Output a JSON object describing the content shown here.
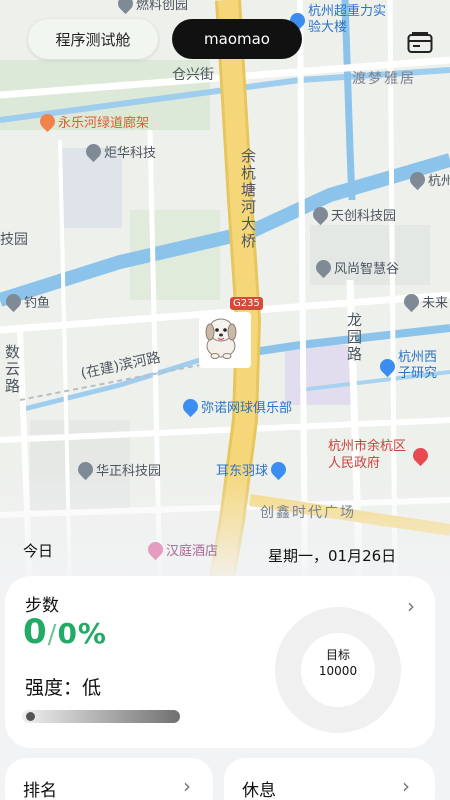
{
  "header": {
    "app_button": "程序测试舱",
    "user_button": "maomao",
    "wallet_icon": "wallet-icon"
  },
  "map": {
    "pois": [
      {
        "name": "燃料创园"
      },
      {
        "name": "杭州超重力实验大楼"
      },
      {
        "name": "永乐河绿道廊架"
      },
      {
        "name": "炬华科技"
      },
      {
        "name": "杭州"
      },
      {
        "name": "天创科技园"
      },
      {
        "name": "风尚智慧谷"
      },
      {
        "name": "未来"
      },
      {
        "name": "钓鱼"
      },
      {
        "name": "杭州西子研究"
      },
      {
        "name": "弥诺网球俱乐部"
      },
      {
        "name": "杭州市余杭区人民政府"
      },
      {
        "name": "华正科技园"
      },
      {
        "name": "耳东羽球"
      },
      {
        "name": "汉庭酒店"
      }
    ],
    "roads": {
      "cangxing": "仓兴街",
      "yuhang_bridge": "余杭塘河大桥",
      "longyuan": "龙园路",
      "binhe": "(在建)滨河路",
      "shuyun": "数云路",
      "ji_yuan": "技园"
    },
    "districts": {
      "dumeng": "渡梦雅居",
      "chuangxin": "创鑫时代广场"
    },
    "shield": "G235",
    "avatar": "dog-avatar"
  },
  "dates": {
    "today": "今日",
    "full_date": "星期一，01月26日"
  },
  "steps_card": {
    "title": "步数",
    "value": "0",
    "slash": "/",
    "percent": "0%",
    "intensity": "强度：低",
    "progress_fraction": 0.0,
    "goal_label": "目标",
    "goal_value": "10000"
  },
  "bottom_cards": {
    "rank": "排名",
    "rest": "休息"
  },
  "colors": {
    "accent_green": "#22aa66",
    "road_yellow": "#f5d77a",
    "river_blue": "#8cc3ea"
  }
}
